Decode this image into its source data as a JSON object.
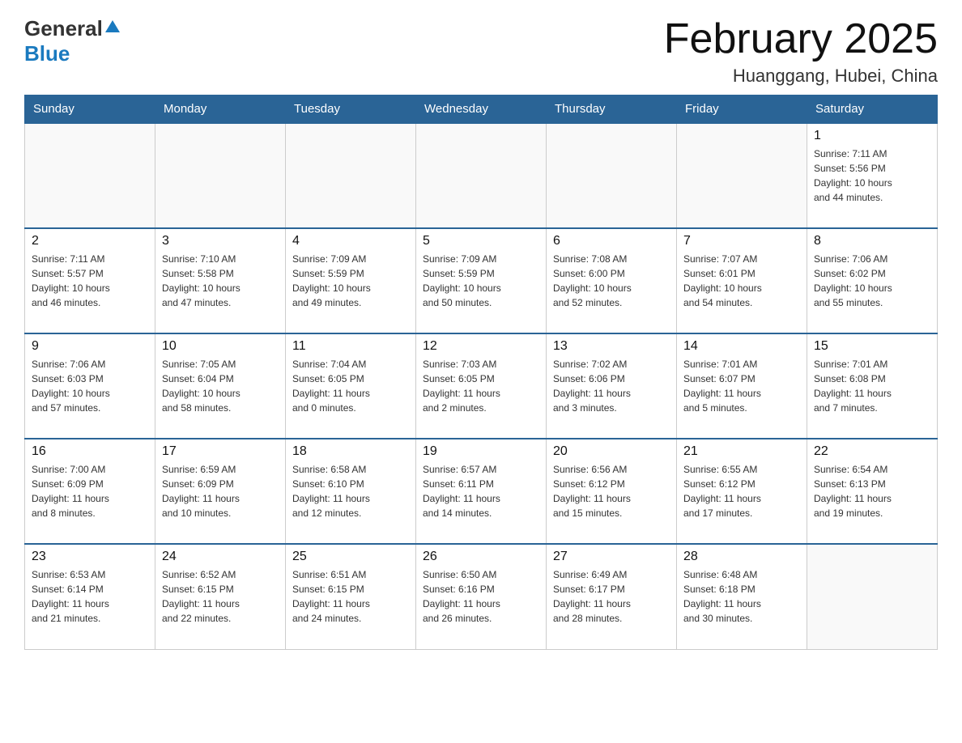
{
  "header": {
    "logo_general": "General",
    "logo_blue": "Blue",
    "month_title": "February 2025",
    "location": "Huanggang, Hubei, China"
  },
  "weekdays": [
    "Sunday",
    "Monday",
    "Tuesday",
    "Wednesday",
    "Thursday",
    "Friday",
    "Saturday"
  ],
  "weeks": [
    [
      {
        "day": "",
        "info": ""
      },
      {
        "day": "",
        "info": ""
      },
      {
        "day": "",
        "info": ""
      },
      {
        "day": "",
        "info": ""
      },
      {
        "day": "",
        "info": ""
      },
      {
        "day": "",
        "info": ""
      },
      {
        "day": "1",
        "info": "Sunrise: 7:11 AM\nSunset: 5:56 PM\nDaylight: 10 hours\nand 44 minutes."
      }
    ],
    [
      {
        "day": "2",
        "info": "Sunrise: 7:11 AM\nSunset: 5:57 PM\nDaylight: 10 hours\nand 46 minutes."
      },
      {
        "day": "3",
        "info": "Sunrise: 7:10 AM\nSunset: 5:58 PM\nDaylight: 10 hours\nand 47 minutes."
      },
      {
        "day": "4",
        "info": "Sunrise: 7:09 AM\nSunset: 5:59 PM\nDaylight: 10 hours\nand 49 minutes."
      },
      {
        "day": "5",
        "info": "Sunrise: 7:09 AM\nSunset: 5:59 PM\nDaylight: 10 hours\nand 50 minutes."
      },
      {
        "day": "6",
        "info": "Sunrise: 7:08 AM\nSunset: 6:00 PM\nDaylight: 10 hours\nand 52 minutes."
      },
      {
        "day": "7",
        "info": "Sunrise: 7:07 AM\nSunset: 6:01 PM\nDaylight: 10 hours\nand 54 minutes."
      },
      {
        "day": "8",
        "info": "Sunrise: 7:06 AM\nSunset: 6:02 PM\nDaylight: 10 hours\nand 55 minutes."
      }
    ],
    [
      {
        "day": "9",
        "info": "Sunrise: 7:06 AM\nSunset: 6:03 PM\nDaylight: 10 hours\nand 57 minutes."
      },
      {
        "day": "10",
        "info": "Sunrise: 7:05 AM\nSunset: 6:04 PM\nDaylight: 10 hours\nand 58 minutes."
      },
      {
        "day": "11",
        "info": "Sunrise: 7:04 AM\nSunset: 6:05 PM\nDaylight: 11 hours\nand 0 minutes."
      },
      {
        "day": "12",
        "info": "Sunrise: 7:03 AM\nSunset: 6:05 PM\nDaylight: 11 hours\nand 2 minutes."
      },
      {
        "day": "13",
        "info": "Sunrise: 7:02 AM\nSunset: 6:06 PM\nDaylight: 11 hours\nand 3 minutes."
      },
      {
        "day": "14",
        "info": "Sunrise: 7:01 AM\nSunset: 6:07 PM\nDaylight: 11 hours\nand 5 minutes."
      },
      {
        "day": "15",
        "info": "Sunrise: 7:01 AM\nSunset: 6:08 PM\nDaylight: 11 hours\nand 7 minutes."
      }
    ],
    [
      {
        "day": "16",
        "info": "Sunrise: 7:00 AM\nSunset: 6:09 PM\nDaylight: 11 hours\nand 8 minutes."
      },
      {
        "day": "17",
        "info": "Sunrise: 6:59 AM\nSunset: 6:09 PM\nDaylight: 11 hours\nand 10 minutes."
      },
      {
        "day": "18",
        "info": "Sunrise: 6:58 AM\nSunset: 6:10 PM\nDaylight: 11 hours\nand 12 minutes."
      },
      {
        "day": "19",
        "info": "Sunrise: 6:57 AM\nSunset: 6:11 PM\nDaylight: 11 hours\nand 14 minutes."
      },
      {
        "day": "20",
        "info": "Sunrise: 6:56 AM\nSunset: 6:12 PM\nDaylight: 11 hours\nand 15 minutes."
      },
      {
        "day": "21",
        "info": "Sunrise: 6:55 AM\nSunset: 6:12 PM\nDaylight: 11 hours\nand 17 minutes."
      },
      {
        "day": "22",
        "info": "Sunrise: 6:54 AM\nSunset: 6:13 PM\nDaylight: 11 hours\nand 19 minutes."
      }
    ],
    [
      {
        "day": "23",
        "info": "Sunrise: 6:53 AM\nSunset: 6:14 PM\nDaylight: 11 hours\nand 21 minutes."
      },
      {
        "day": "24",
        "info": "Sunrise: 6:52 AM\nSunset: 6:15 PM\nDaylight: 11 hours\nand 22 minutes."
      },
      {
        "day": "25",
        "info": "Sunrise: 6:51 AM\nSunset: 6:15 PM\nDaylight: 11 hours\nand 24 minutes."
      },
      {
        "day": "26",
        "info": "Sunrise: 6:50 AM\nSunset: 6:16 PM\nDaylight: 11 hours\nand 26 minutes."
      },
      {
        "day": "27",
        "info": "Sunrise: 6:49 AM\nSunset: 6:17 PM\nDaylight: 11 hours\nand 28 minutes."
      },
      {
        "day": "28",
        "info": "Sunrise: 6:48 AM\nSunset: 6:18 PM\nDaylight: 11 hours\nand 30 minutes."
      },
      {
        "day": "",
        "info": ""
      }
    ]
  ]
}
